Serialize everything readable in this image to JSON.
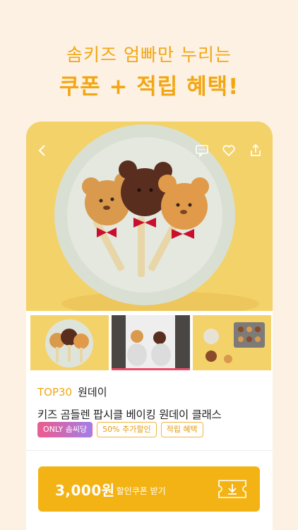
{
  "headline": {
    "line1": "솜키즈 엄빠만 누리는",
    "line2": "쿠폰 + 적립 혜택!"
  },
  "hero": {
    "icons": [
      "back-arrow-icon",
      "chat-icon",
      "heart-icon",
      "share-icon"
    ]
  },
  "product": {
    "rank": "TOP30",
    "category": "원데이",
    "title": "키즈 곰들렌 팝시클 베이킹 원데이 클래스",
    "badges": {
      "only": "ONLY 솜씨당",
      "discount": "50% 추가할인",
      "points": "적립 혜택"
    }
  },
  "coupon": {
    "amount": "3,000원",
    "label": "할인쿠폰 받기",
    "icon": "coupon-download-icon"
  },
  "colors": {
    "background": "#fdf1e4",
    "accent": "#f2a712",
    "coupon": "#f4b315",
    "pink": "#ee4a6a"
  }
}
